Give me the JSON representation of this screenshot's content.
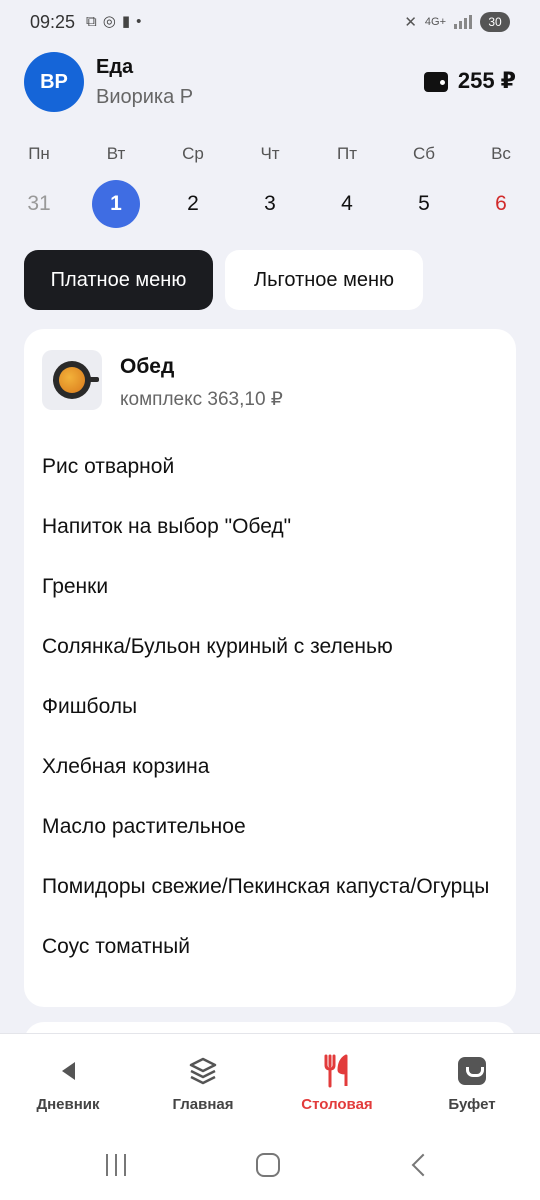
{
  "status_bar": {
    "time": "09:25",
    "battery": "30",
    "network": "4G+"
  },
  "header": {
    "avatar_initials": "ВР",
    "title": "Еда",
    "user_name": "Виорика Р",
    "balance": "255 ₽"
  },
  "week": {
    "days": [
      {
        "name": "Пн",
        "num": "31"
      },
      {
        "name": "Вт",
        "num": "1"
      },
      {
        "name": "Ср",
        "num": "2"
      },
      {
        "name": "Чт",
        "num": "3"
      },
      {
        "name": "Пт",
        "num": "4"
      },
      {
        "name": "Сб",
        "num": "5"
      },
      {
        "name": "Вс",
        "num": "6"
      }
    ]
  },
  "tabs": {
    "paid": "Платное меню",
    "preferential": "Льготное меню"
  },
  "meal": {
    "title": "Обед",
    "price": "комплекс 363,10 ₽",
    "dishes": [
      "Рис отварной",
      "Напиток на выбор \"Обед\"",
      "Гренки",
      "Солянка/Бульон куриный с зеленью",
      "Фишболы",
      "Хлебная корзина",
      "Масло растительное",
      "Помидоры свежие/Пекинская капуста/Огурцы",
      "Соус томатный"
    ]
  },
  "bottom_nav": {
    "diary": "Дневник",
    "main": "Главная",
    "canteen": "Столовая",
    "buffet": "Буфет"
  },
  "colors": {
    "accent_blue": "#3f6de3",
    "avatar_blue": "#1565d8",
    "active_red": "#e23b3b",
    "weekend_red": "#d12b2b"
  }
}
